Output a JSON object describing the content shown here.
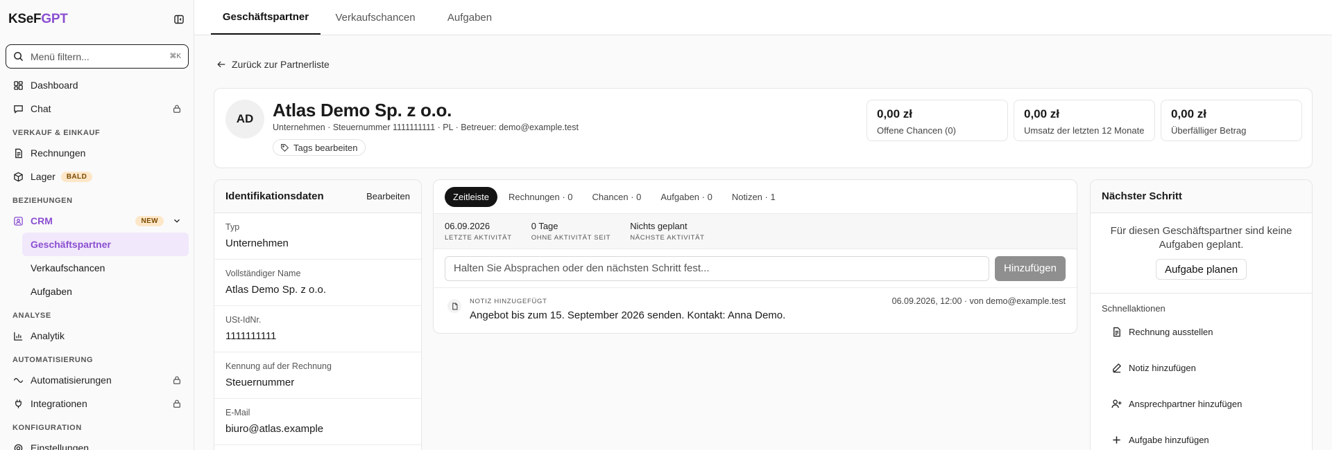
{
  "brand": {
    "part1": "KSeF",
    "part2": "GPT"
  },
  "search": {
    "placeholder": "Menü filtern...",
    "shortcut": "⌘K"
  },
  "nav": {
    "dashboard": "Dashboard",
    "chat": "Chat",
    "section_sales": "VERKAUF & EINKAUF",
    "invoices": "Rechnungen",
    "stock": "Lager",
    "stock_badge": "BALD",
    "section_relations": "BEZIEHUNGEN",
    "crm": "CRM",
    "crm_badge": "NEW",
    "crm_sub": [
      "Geschäftspartner",
      "Verkaufschancen",
      "Aufgaben"
    ],
    "section_analysis": "ANALYSE",
    "analytics": "Analytik",
    "section_automation": "AUTOMATISIERUNG",
    "automations": "Automatisierungen",
    "integrations": "Integrationen",
    "section_config": "KONFIGURATION",
    "settings": "Einstellungen"
  },
  "tabs": [
    "Geschäftspartner",
    "Verkaufschancen",
    "Aufgaben"
  ],
  "back_label": "Zurück zur Partnerliste",
  "partner": {
    "initials": "AD",
    "name": "Atlas Demo Sp. z o.o.",
    "meta": "Unternehmen · Steuernummer 1111111111 · PL · Betreuer: demo@example.test",
    "tags_label": "Tags bearbeiten"
  },
  "stats": [
    {
      "value": "0,00 zł",
      "label": "Offene Chancen (0)"
    },
    {
      "value": "0,00 zł",
      "label": "Umsatz der letzten 12 Monate"
    },
    {
      "value": "0,00 zł",
      "label": "Überfälliger Betrag"
    }
  ],
  "identification": {
    "title": "Identifikationsdaten",
    "edit": "Bearbeiten",
    "fields": [
      {
        "label": "Typ",
        "value": "Unternehmen"
      },
      {
        "label": "Vollständiger Name",
        "value": "Atlas Demo Sp. z o.o."
      },
      {
        "label": "USt-IdNr.",
        "value": "1111111111"
      },
      {
        "label": "Kennung auf der Rechnung",
        "value": "Steuernummer"
      },
      {
        "label": "E-Mail",
        "value": "biuro@atlas.example"
      }
    ]
  },
  "timeline": {
    "tabs": [
      "Zeitleiste",
      "Rechnungen · 0",
      "Chancen · 0",
      "Aufgaben · 0",
      "Notizen · 1"
    ],
    "stats": [
      {
        "value": "06.09.2026",
        "label": "LETZTE AKTIVITÄT"
      },
      {
        "value": "0 Tage",
        "label": "OHNE AKTIVITÄT SEIT"
      },
      {
        "value": "Nichts geplant",
        "label": "NÄCHSTE AKTIVITÄT"
      }
    ],
    "input_placeholder": "Halten Sie Absprachen oder den nächsten Schritt fest...",
    "add_label": "Hinzufügen",
    "entry": {
      "kind": "NOTIZ HINZUGEFÜGT",
      "time": "06.09.2026, 12:00 · von demo@example.test",
      "text": "Angebot bis zum 15. September 2026 senden. Kontakt: Anna Demo."
    }
  },
  "next_step": {
    "title": "Nächster Schritt",
    "empty": "Für diesen Geschäftspartner sind keine Aufgaben geplant.",
    "plan_label": "Aufgabe planen",
    "quick_title": "Schnellaktionen",
    "quick": [
      "Rechnung ausstellen",
      "Notiz hinzufügen",
      "Ansprechpartner hinzufügen",
      "Aufgabe hinzufügen"
    ]
  },
  "colors": {
    "accent": "#8b4fd1",
    "badge_bg": "#fde7c8"
  }
}
